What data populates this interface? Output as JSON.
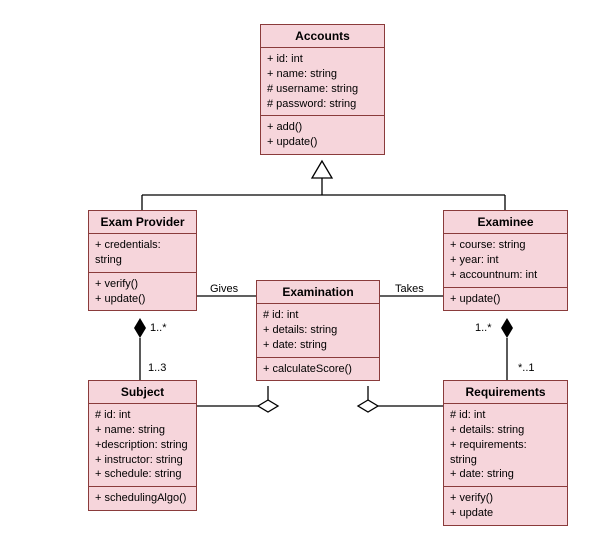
{
  "classes": {
    "accounts": {
      "title": "Accounts",
      "attrs": "+ id: int\n+ name: string\n# username: string\n# password: string",
      "ops": "+ add()\n+ update()"
    },
    "examProvider": {
      "title": "Exam Provider",
      "attrs": "+ credentials:\nstring",
      "ops": "+ verify()\n+ update()"
    },
    "examinee": {
      "title": "Examinee",
      "attrs": "+ course: string\n+ year: int\n+ accountnum: int",
      "ops": "+ update()"
    },
    "examination": {
      "title": "Examination",
      "attrs": "# id: int\n+ details: string\n+ date: string",
      "ops": "+ calculateScore()"
    },
    "subject": {
      "title": "Subject",
      "attrs": "# id: int\n+ name: string\n+description: string\n+ instructor: string\n+ schedule: string",
      "ops": "+ schedulingAlgo()"
    },
    "requirements": {
      "title": "Requirements",
      "attrs": "# id: int\n+ details: string\n+ requirements:\nstring\n+ date: string",
      "ops": "+ verify()\n+ update"
    }
  },
  "labels": {
    "gives": "Gives",
    "takes": "Takes",
    "m1star_left": "1..*",
    "m1_3": "1..3",
    "m1star_right": "1..*",
    "mstar1": "*..1"
  },
  "chart_data": {
    "type": "uml-class-diagram",
    "classes": [
      {
        "name": "Accounts",
        "attributes": [
          "+ id: int",
          "+ name: string",
          "# username: string",
          "# password: string"
        ],
        "operations": [
          "+ add()",
          "+ update()"
        ]
      },
      {
        "name": "Exam Provider",
        "attributes": [
          "+ credentials: string"
        ],
        "operations": [
          "+ verify()",
          "+ update()"
        ]
      },
      {
        "name": "Examinee",
        "attributes": [
          "+ course: string",
          "+ year: int",
          "+ accountnum: int"
        ],
        "operations": [
          "+ update()"
        ]
      },
      {
        "name": "Examination",
        "attributes": [
          "# id: int",
          "+ details: string",
          "+ date: string"
        ],
        "operations": [
          "+ calculateScore()"
        ]
      },
      {
        "name": "Subject",
        "attributes": [
          "# id: int",
          "+ name: string",
          "+description: string",
          "+ instructor: string",
          "+ schedule: string"
        ],
        "operations": [
          "+ schedulingAlgo()"
        ]
      },
      {
        "name": "Requirements",
        "attributes": [
          "# id: int",
          "+ details: string",
          "+ requirements: string",
          "+ date: string"
        ],
        "operations": [
          "+ verify()",
          "+ update"
        ]
      }
    ],
    "relationships": [
      {
        "type": "generalization",
        "from": "Exam Provider",
        "to": "Accounts"
      },
      {
        "type": "generalization",
        "from": "Examinee",
        "to": "Accounts"
      },
      {
        "type": "association",
        "from": "Exam Provider",
        "to": "Examination",
        "label": "Gives"
      },
      {
        "type": "association",
        "from": "Examinee",
        "to": "Examination",
        "label": "Takes"
      },
      {
        "type": "composition",
        "from": "Exam Provider",
        "to": "Subject",
        "multiplicity": {
          "Exam Provider": "1..*",
          "Subject": "1..3"
        }
      },
      {
        "type": "composition",
        "from": "Examinee",
        "to": "Requirements",
        "multiplicity": {
          "Examinee": "1..*",
          "Requirements": "*..1"
        }
      },
      {
        "type": "aggregation",
        "from": "Examination",
        "to": "Subject"
      },
      {
        "type": "aggregation",
        "from": "Examination",
        "to": "Requirements"
      }
    ]
  }
}
